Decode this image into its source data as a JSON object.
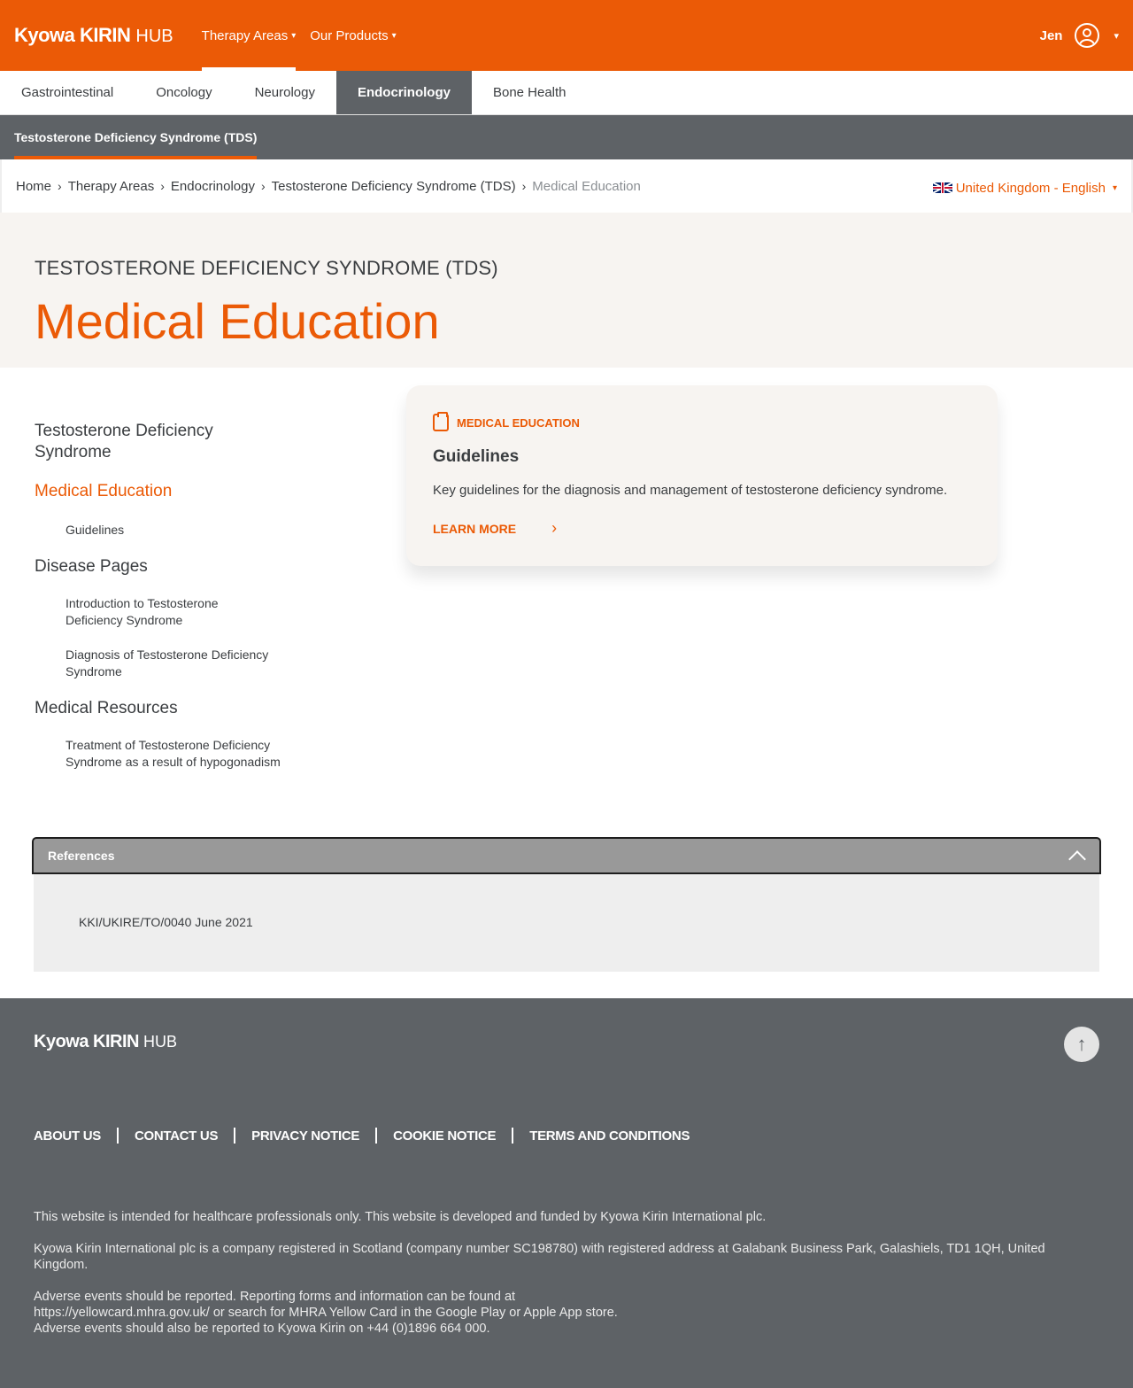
{
  "header": {
    "logo_brand": "Kyowa KIRIN",
    "logo_hub": "HUB",
    "nav": [
      {
        "label": "Therapy Areas",
        "caret": "▾"
      },
      {
        "label": "Our Products",
        "caret": "▾"
      }
    ],
    "user_name": "Jen",
    "user_caret": "▾"
  },
  "therapy_tabs": [
    "Gastrointestinal",
    "Oncology",
    "Neurology",
    "Endocrinology",
    "Bone Health"
  ],
  "active_tab": "Endocrinology",
  "subbar": {
    "label": "Testosterone Deficiency Syndrome (TDS)"
  },
  "breadcrumb": {
    "items": [
      "Home",
      "Therapy Areas",
      "Endocrinology",
      "Testosterone Deficiency Syndrome (TDS)",
      "Medical Education"
    ],
    "separator": "›"
  },
  "locale": {
    "label": "United Kingdom - English",
    "caret": "▾"
  },
  "hero": {
    "eyebrow": "TESTOSTERONE DEFICIENCY SYNDROME (TDS)",
    "title": "Medical Education"
  },
  "sidenav": {
    "sections": [
      {
        "label": "Testosterone Deficiency Syndrome",
        "items": []
      },
      {
        "label": "Medical Education",
        "items": [
          "Guidelines"
        ]
      },
      {
        "label": "Disease Pages",
        "items": [
          "Introduction to Testosterone Deficiency Syndrome",
          "Diagnosis of Testosterone Deficiency Syndrome"
        ]
      },
      {
        "label": "Medical Resources",
        "items": [
          "Treatment of Testosterone Deficiency Syndrome as a result of hypogonadism"
        ]
      }
    ]
  },
  "card": {
    "kicker": "MEDICAL EDUCATION",
    "title": "Guidelines",
    "description": "Key guidelines for the diagnosis and management of testosterone deficiency syndrome.",
    "cta": "LEARN MORE",
    "cta_icon": "›"
  },
  "references": {
    "heading": "References",
    "code": "KKI/UKIRE/TO/0040 June 2021"
  },
  "footer": {
    "logo_brand": "Kyowa KIRIN",
    "logo_hub": "HUB",
    "links": [
      "ABOUT US",
      "CONTACT US",
      "PRIVACY NOTICE",
      "COOKIE NOTICE",
      "TERMS AND CONDITIONS"
    ],
    "top_icon": "↑",
    "texts": [
      "This website is intended for healthcare professionals only. This website is developed and funded by Kyowa Kirin International plc.",
      "Kyowa Kirin International plc is a company registered in Scotland (company number SC198780) with registered address at Galabank Business Park, Galashiels, TD1 1QH, United Kingdom.",
      "Adverse events should be reported. Reporting forms and information can be found at https://yellowcard.mhra.gov.uk/ or search for MHRA Yellow Card in the Google Play or Apple App store.",
      "Adverse events should also be reported to Kyowa Kirin on +44 (0)1896 664 000."
    ]
  },
  "colors": {
    "brand": "#eb5a06",
    "dark_grey": "#5e6266",
    "cream": "#f7f4f1"
  }
}
